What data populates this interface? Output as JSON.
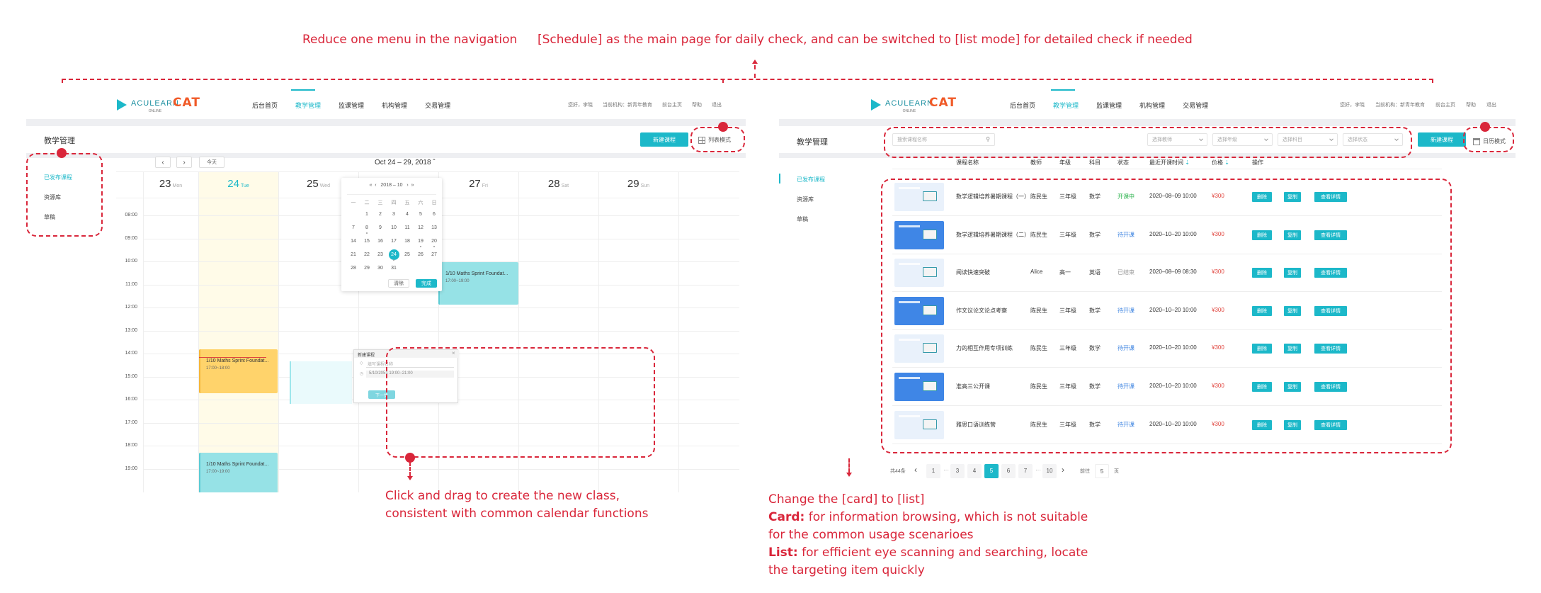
{
  "annotations": {
    "top_left": "Reduce one menu in the navigation",
    "top_right": "[Schedule] as the main page for daily check, and can be switched to [list mode] for detailed check if needed",
    "drag_line1": "Click and drag to create the new class,",
    "drag_line2": "consistent with common calendar functions",
    "change_title": "Change the [card] to [list]",
    "card_label": "Card:",
    "card_text": "for information browsing, which is not suitable",
    "card_text2": "for the common usage scenarioes",
    "list_label": "List:",
    "list_text": "for efficient eye scanning and searching, locate",
    "list_text2": "the targeting item quickly"
  },
  "brand": {
    "logo_text": "ACULEARN",
    "logo_sub": "ONLINE",
    "product": "CAT"
  },
  "nav": [
    "后台首页",
    "教学管理",
    "监课管理",
    "机构管理",
    "交易管理"
  ],
  "meta": {
    "greeting": "您好，李晓",
    "org": "当前机构：新青年教育",
    "front": "前台主页",
    "help": "帮助",
    "logout": "退出"
  },
  "page_title": "教学管理",
  "sidebar": [
    "已发布课程",
    "资源库",
    "草稿"
  ],
  "calendar": {
    "new_course": "新建课程",
    "list_mode": "列表模式",
    "prev": "‹",
    "next": "›",
    "today": "今天",
    "range": "Oct 24 – 29, 2018 ˆ",
    "days": [
      {
        "num": "23",
        "name": "Mon"
      },
      {
        "num": "24",
        "name": "Tue"
      },
      {
        "num": "25",
        "name": "Wed"
      },
      {
        "num": "26",
        "name": "Thu"
      },
      {
        "num": "27",
        "name": "Fri"
      },
      {
        "num": "28",
        "name": "Sat"
      },
      {
        "num": "29",
        "name": "Sun"
      }
    ],
    "times": [
      "08:00",
      "09:00",
      "10:00",
      "11:00",
      "12:00",
      "13:00",
      "14:00",
      "15:00",
      "16:00",
      "17:00",
      "18:00",
      "19:00"
    ],
    "events": [
      {
        "title": "1/10 Maths Sprint Foundat...",
        "time": "17:00~19:00"
      },
      {
        "title": "1/10 Maths Sprint Foundat...",
        "time": "17:00~18:00"
      },
      {
        "title": "1/10 Maths Sprint Foundat...",
        "time": "17:00~19:00"
      }
    ],
    "picker": {
      "header": "«  ‹   2018 – 10   ›  »",
      "weekdays": [
        "一",
        "二",
        "三",
        "四",
        "五",
        "六",
        "日"
      ],
      "rows": [
        [
          "",
          "1",
          "2",
          "3",
          "4",
          "5",
          "6"
        ],
        [
          "7",
          "8",
          "9",
          "10",
          "11",
          "12",
          "13"
        ],
        [
          "14",
          "15",
          "16",
          "17",
          "18",
          "19",
          "20"
        ],
        [
          "21",
          "22",
          "23",
          "24",
          "25",
          "26",
          "27"
        ],
        [
          "28",
          "29",
          "30",
          "31",
          "",
          "",
          ""
        ]
      ],
      "clear": "清除",
      "done": "完成"
    },
    "dialog": {
      "title": "新建课程",
      "name_placeholder": "填写课程名称",
      "datetime": "5/10/2051  19:00–21:00",
      "next": "下一步"
    }
  },
  "list": {
    "search_placeholder": "搜索课程名称",
    "filters": [
      "选择教师",
      "选择年级",
      "选择科目",
      "选择状态"
    ],
    "new_course": "新建课程",
    "calendar_mode": "日历模式",
    "headers": [
      "课程名称",
      "教师",
      "年级",
      "科目",
      "状态",
      "最近开课时间",
      "价格",
      "操作"
    ],
    "rows": [
      {
        "name": "数学逻辑培养暑期课程（一）",
        "teacher": "陈民生",
        "grade": "三年级",
        "subject": "数学",
        "status": "开课中",
        "time": "2020–08–09 10:00",
        "price": "¥300",
        "thumb": "w"
      },
      {
        "name": "数学逻辑培养暑期课程（二）",
        "teacher": "陈民生",
        "grade": "三年级",
        "subject": "数学",
        "status": "待开课",
        "time": "2020–10–20 10:00",
        "price": "¥300",
        "thumb": "b"
      },
      {
        "name": "阅读快速突破",
        "teacher": "Alice",
        "grade": "高一",
        "subject": "英语",
        "status": "已结束",
        "time": "2020–08–09 08:30",
        "price": "¥300",
        "thumb": "w"
      },
      {
        "name": "作文议论文论点考察",
        "teacher": "陈民生",
        "grade": "三年级",
        "subject": "数学",
        "status": "待开课",
        "time": "2020–10–20 10:00",
        "price": "¥300",
        "thumb": "b"
      },
      {
        "name": "力的相互作用专项训练",
        "teacher": "陈民生",
        "grade": "三年级",
        "subject": "数学",
        "status": "待开课",
        "time": "2020–10–20 10:00",
        "price": "¥300",
        "thumb": "w"
      },
      {
        "name": "准高三公开课",
        "teacher": "陈民生",
        "grade": "三年级",
        "subject": "数学",
        "status": "待开课",
        "time": "2020–10–20 10:00",
        "price": "¥300",
        "thumb": "b"
      },
      {
        "name": "雅思口语训练营",
        "teacher": "陈民生",
        "grade": "三年级",
        "subject": "数学",
        "status": "待开课",
        "time": "2020–10–20 10:00",
        "price": "¥300",
        "thumb": "w"
      }
    ],
    "actions": [
      "删除",
      "复制",
      "查看详情"
    ],
    "pagination": {
      "total": "共44条",
      "prev": "‹",
      "pages": [
        "1",
        "···",
        "3",
        "4",
        "5",
        "6",
        "7",
        "···",
        "10"
      ],
      "next": "›",
      "goto": "前往",
      "page_input": "5",
      "page_suffix": "页"
    }
  },
  "colors": {
    "accent": "#1cb8c9",
    "annotation": "#d9263a",
    "price": "#e0433c",
    "event_teal": "#96e2e6",
    "event_yellow": "#ffd36b"
  }
}
